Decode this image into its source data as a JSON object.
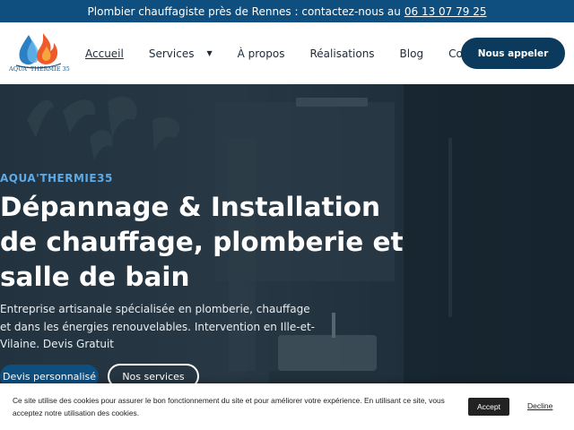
{
  "topbar": {
    "text": "Plombier chauffagiste près de Rennes : contactez-nous au",
    "phone": "06 13 07 79 25"
  },
  "header": {
    "logo_text": "AQUA' THERMIE 35",
    "nav": [
      {
        "label": "Accueil"
      },
      {
        "label": "Services"
      },
      {
        "label": "À propos"
      },
      {
        "label": "Réalisations"
      },
      {
        "label": "Blog"
      },
      {
        "label": "Contact"
      }
    ],
    "call_button": "Nous appeler"
  },
  "hero": {
    "eyebrow": "AQUA'THERMIE35",
    "headline": "Dépannage & Installation de chauffage, plomberie et salle de bain",
    "subtext": "Entreprise artisanale spécialisée en plomberie, chauffage et dans les énergies renouvelables. Intervention en Ille-et-Vilaine. Devis Gratuit",
    "primary_button": "Devis personnalisé",
    "secondary_button": "Nos services"
  },
  "cookie": {
    "text": "Ce site utilise des cookies pour assurer le bon fonctionnement du site et pour améliorer votre expérience. En utilisant ce site, vous acceptez notre utilisation des cookies.",
    "accept": "Accept",
    "decline": "Decline"
  },
  "colors": {
    "brand_dark": "#0b3a5c",
    "brand": "#0e4f80",
    "accent": "#5fa9e4"
  },
  "icons": {
    "logo": "flame-drop-logo",
    "dropdown": "chevron-down-icon"
  }
}
